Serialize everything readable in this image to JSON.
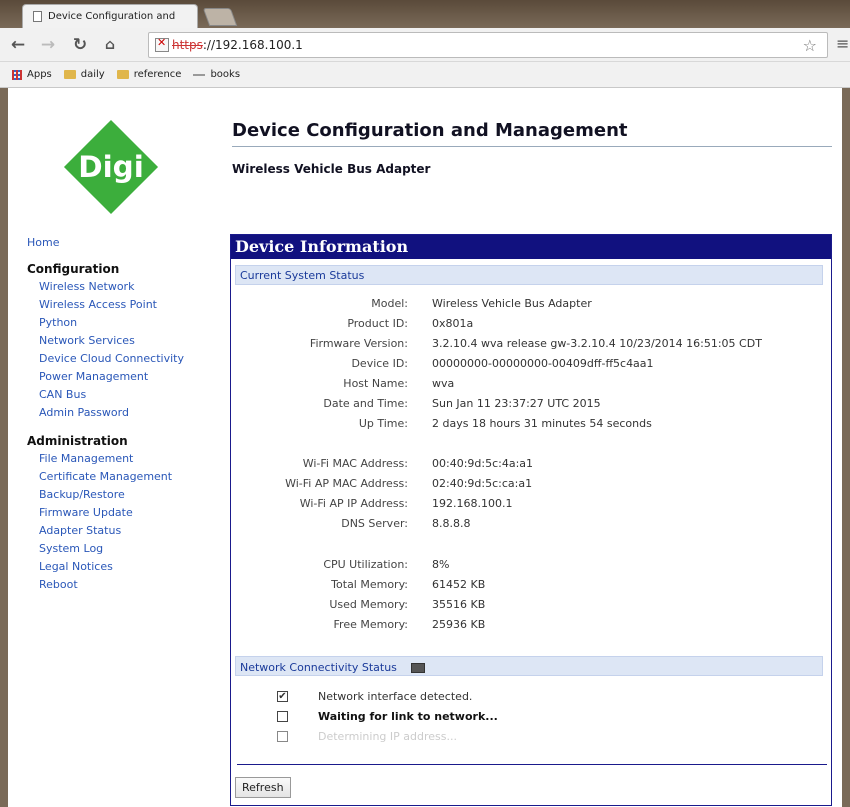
{
  "browser": {
    "tab_title": "Device Configuration and",
    "url_scheme": "https",
    "url_host": "://192.168.100.1",
    "bookmarks": [
      "Apps",
      "daily",
      "reference",
      "books"
    ]
  },
  "header": {
    "logo_text": "Digi",
    "title": "Device Configuration and Management",
    "subtitle": "Wireless Vehicle Bus Adapter"
  },
  "nav": {
    "home": "Home",
    "configuration": {
      "label": "Configuration",
      "items": [
        "Wireless Network",
        "Wireless Access Point",
        "Python",
        "Network Services",
        "Device Cloud Connectivity",
        "Power Management",
        "CAN Bus",
        "Admin Password"
      ]
    },
    "administration": {
      "label": "Administration",
      "items": [
        "File Management",
        "Certificate Management",
        "Backup/Restore",
        "Firmware Update",
        "Adapter Status",
        "System Log",
        "Legal Notices",
        "Reboot"
      ]
    }
  },
  "panel": {
    "title": "Device Information",
    "system_status_header": "Current System Status",
    "rows": [
      {
        "label": "Model:",
        "value": "Wireless Vehicle Bus Adapter"
      },
      {
        "label": "Product ID:",
        "value": "0x801a"
      },
      {
        "label": "Firmware Version:",
        "value": "3.2.10.4   wva release gw-3.2.10.4 10/23/2014 16:51:05 CDT"
      },
      {
        "label": "Device ID:",
        "value": "00000000-00000000-00409dff-ff5c4aa1"
      },
      {
        "label": "Host Name:",
        "value": "wva"
      },
      {
        "label": "Date and Time:",
        "value": "Sun Jan 11 23:37:27 UTC 2015"
      },
      {
        "label": "Up Time:",
        "value": "2 days 18 hours 31 minutes 54 seconds"
      }
    ],
    "network_rows": [
      {
        "label": "Wi-Fi MAC Address:",
        "value": "00:40:9d:5c:4a:a1"
      },
      {
        "label": "Wi-Fi AP MAC Address:",
        "value": "02:40:9d:5c:ca:a1"
      },
      {
        "label": "Wi-Fi AP IP Address:",
        "value": "192.168.100.1"
      },
      {
        "label": "DNS Server:",
        "value": "8.8.8.8"
      }
    ],
    "resource_rows": [
      {
        "label": "CPU Utilization:",
        "value": "8%"
      },
      {
        "label": "Total Memory:",
        "value": "61452 KB"
      },
      {
        "label": "Used Memory:",
        "value": "35516 KB"
      },
      {
        "label": "Free Memory:",
        "value": "25936 KB"
      }
    ],
    "network_status_header": "Network Connectivity Status",
    "checks": [
      {
        "text": "Network interface detected.",
        "checked": "✔"
      },
      {
        "text": "Waiting for link to network...",
        "checked": ""
      },
      {
        "text": "Determining IP address...",
        "checked": ""
      }
    ],
    "refresh_label": "Refresh"
  }
}
